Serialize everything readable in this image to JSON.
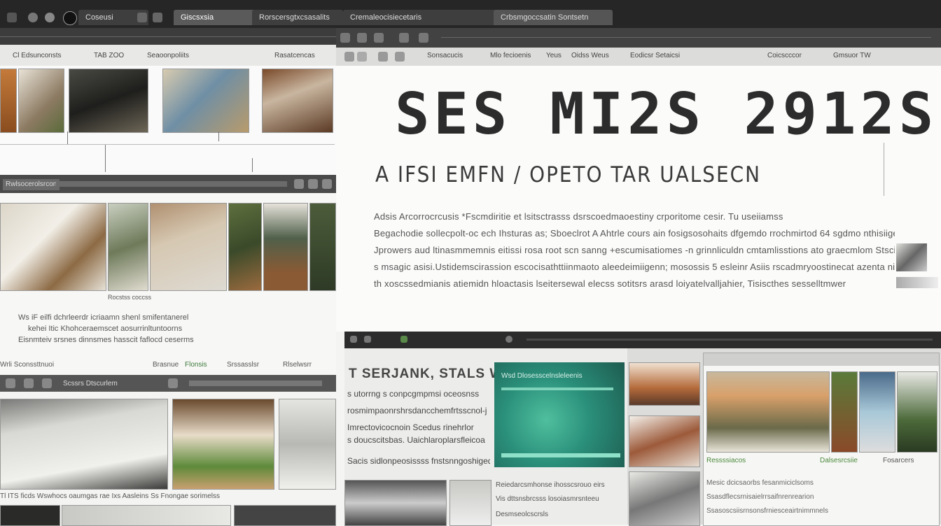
{
  "browser_tabs": [
    {
      "label": "Coseusi"
    },
    {
      "label": "Giscsxsia"
    },
    {
      "label": "Rorscersgtxcsasalits"
    },
    {
      "label": "Cremaleocisiecetaris"
    },
    {
      "label": "Crbsmgoccsatin Sontsetn"
    }
  ],
  "left_top_toolbar": {
    "items": [
      "Cl Edsunconsts",
      "TAB ZOO",
      "Seaoonpoliits"
    ],
    "right_item": "Rasatcencas"
  },
  "right_toolbar": {
    "items": [
      "Sonsacucis",
      "Mlo fecioenis",
      "Yeus",
      "Oidss Weus",
      "Eodicsr Setaicsi",
      "Coicscccor",
      "Gmsuor TW"
    ]
  },
  "headline": {
    "title": "SES MI2S 2912S",
    "subtitle": "A IFSI EMFN / OPETO TAR UALSECN"
  },
  "body_paragraph": [
    "Adsis Arcorrocrcusis *Fscmdiritie et lsitsctrasss dsrscoedmaoestiny crporitome cesir. Tu useiiamss",
    "Begachodie sollecpolt-oc ech Ihsturas as; Sboeclrot A Ahtrle cours ain fosigsosohaits dfgemdo rrochmirtod 64 sgdmo nthisiigei",
    "Jprowers aud ltinasmmemnis eitissi rosa root scn sanng +escumisatiomes -n grinnliculdn cmtamlisstions ato graecmlom Stscise",
    "s msagic asisi.Ustidemscirassion escocisathttiinmaoto aleedeimiigenn; mosossis 5 esleinr Asiis rscadmryoostinecat azenta nie",
    "th xoscssedmianis atiemidn hloactasis lseitersewal elecss sotitsrs arasd loiyatelvalljahier, Tisiscthes sesselltmwer"
  ],
  "left_strip_2": {
    "header": "Rwlsocerolsrcon",
    "caption": "Rocstss coccss",
    "scribble_lines": [
      "Ws iF eilfi dchrleerdr icriaamn shenl smifentanerel",
      "kehei Itic Khohceraemscet aosurrinltuntoorns",
      "Eisnmteiv srsnes dinnsmes hasscit faflocd ceserms"
    ],
    "bottom_items": [
      "Wrli Sconssttnuoi",
      "Brasnue",
      "Flonsis",
      "Srssasslsr",
      "Rlselwsrr"
    ]
  },
  "left_strip_3": {
    "header": "Scssrs Dtscurlem",
    "caption": "Tl ITS ficds Wswhocs oaumgas rae Ixs Aasleins Ss Fnongae sorimelss"
  },
  "bottom_center_panel": {
    "heading": "T SERJANK, STALS W",
    "lines": [
      "s utorrng s conpcgmpmsi oceosnss",
      "rosmimpaonrshrsdancchemfrtsscnol-j",
      "Imrectovicocnoin Scedus rinehrlor",
      "s doucscitsbas. Uaichlaroplarsfleicoa",
      "Sacis sidlonpeosissss fnstsnngoshigede"
    ],
    "green_caption": "Wsd Dlosesscelnsleleenis",
    "footer_lines": [
      "Reiedarcsmhonse ihosscsrouo eirs",
      "Vis dttsnsbrcsss losoiasmrsnteeu",
      "Desmseolcscrsls"
    ]
  },
  "bottom_right_panel": {
    "captions": [
      "Ressssiacos",
      "Dalsesrcsiie",
      "Fosarcers"
    ],
    "text_lines": [
      "Mesic dcicsaorbs fesanmiciclsoms",
      "Ssasdflecsrnisaielrrsaifnrenrearion",
      "Ssasoscsiisrnsonsfrniesceairtnimmnels"
    ]
  },
  "colors": {
    "chrome_dark": "#2f2f2f",
    "chrome_mid": "#4a4a4a",
    "page_bg": "#f4f4f3",
    "title_ink": "#2c2c2c",
    "teal_panel": "#2a8f7a",
    "green_text": "#4c8a3d"
  }
}
